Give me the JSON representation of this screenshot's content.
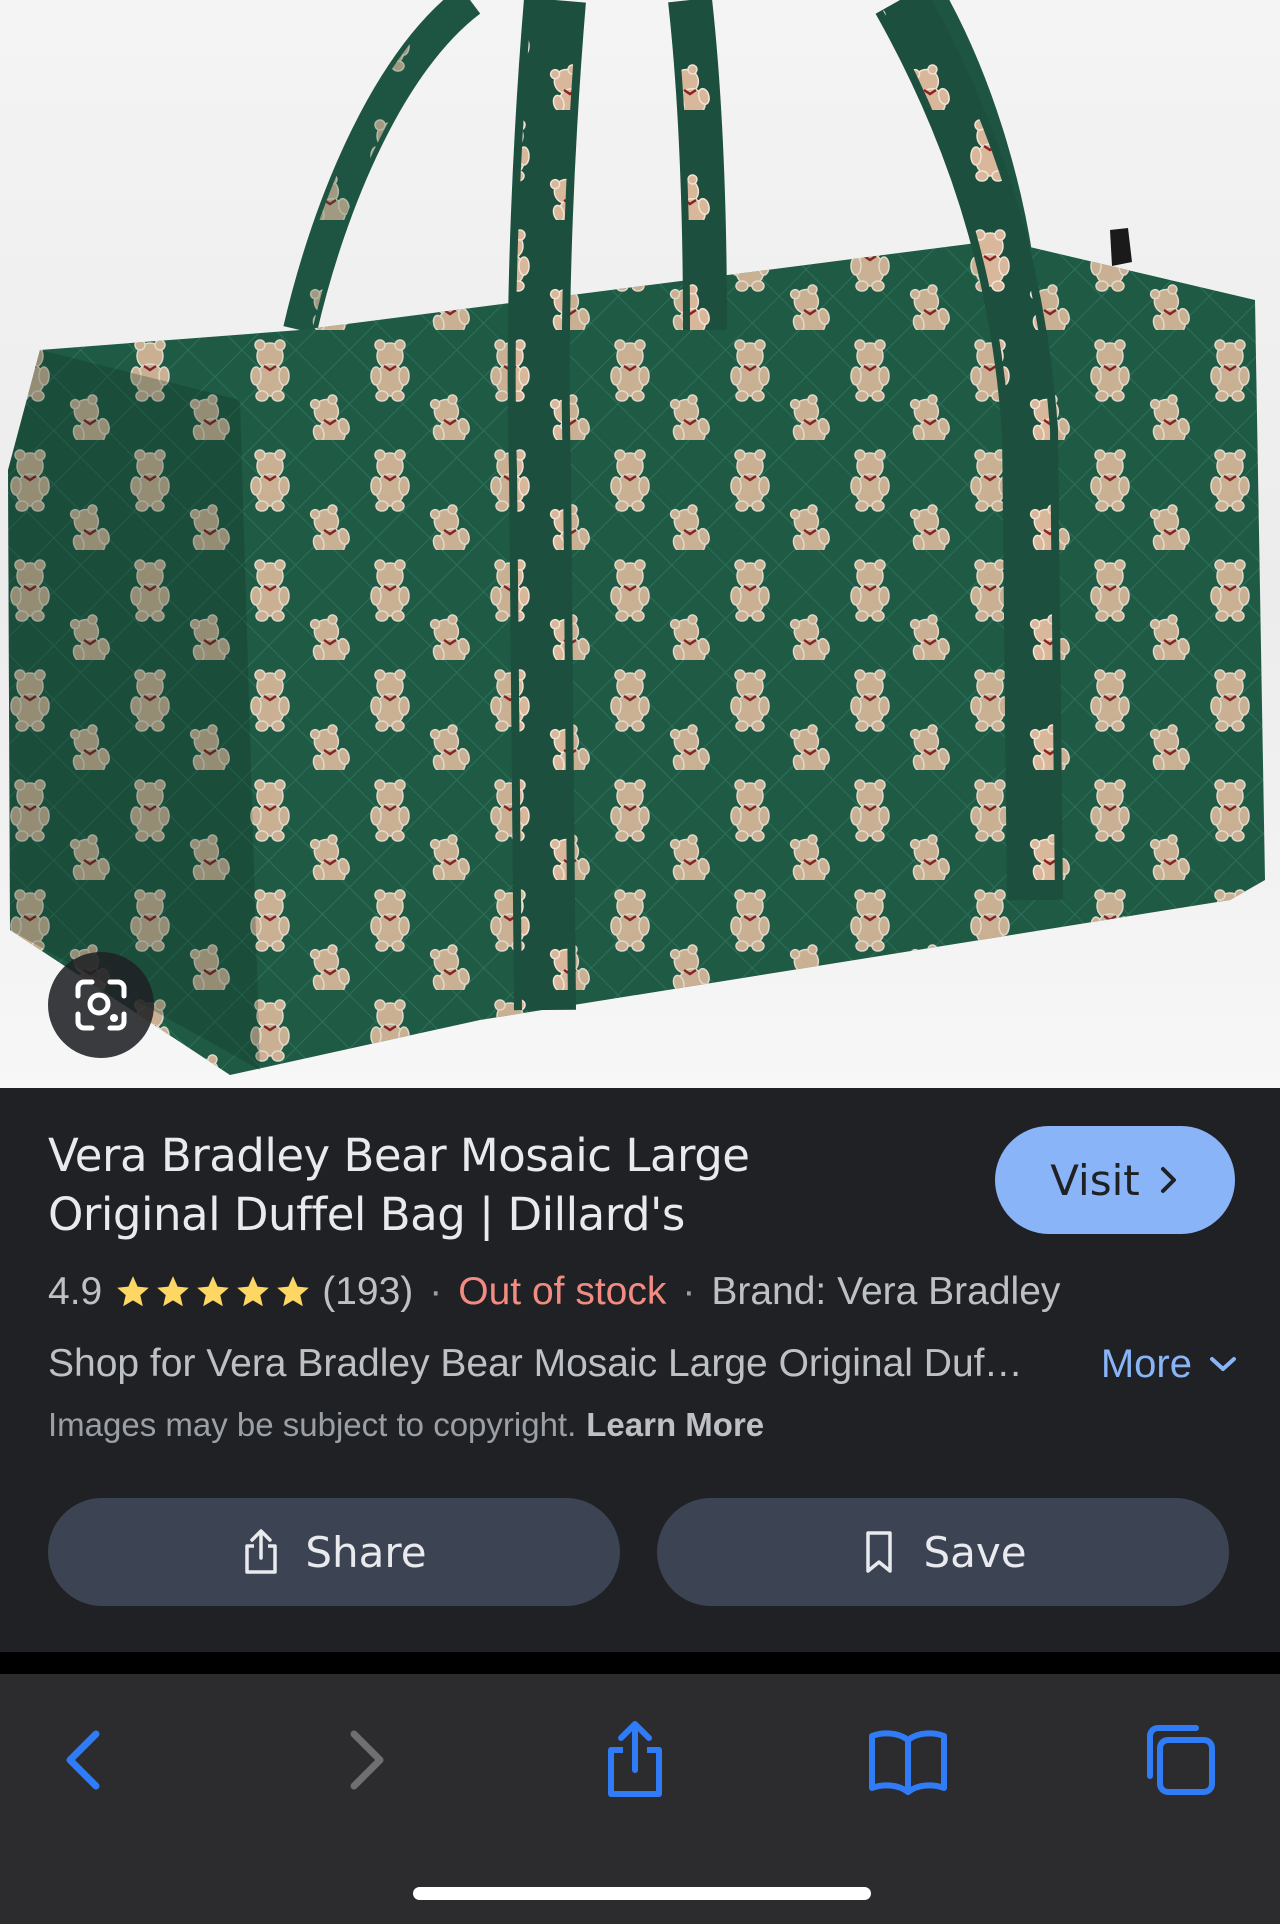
{
  "product": {
    "title": "Vera Bradley Bear Mosaic Large Original Duffel Bag | Dillard's",
    "visit_label": "Visit",
    "rating": "4.9",
    "stars": 5,
    "review_count": "(193)",
    "separator": "·",
    "stock_status": "Out of stock",
    "brand": "Brand: Vera Bradley",
    "description": "Shop for Vera Bradley Bear Mosaic Large Original Duffel Bag at Dillard's",
    "more_label": "More",
    "copyright_text": "Images may be subject to copyright.",
    "learn_more_label": "Learn More",
    "share_label": "Share",
    "save_label": "Save"
  },
  "icons": {
    "lens": "google-lens-icon",
    "visit_chevron": "chevron-right-icon",
    "star": "star-icon",
    "more_chevron": "chevron-down-icon",
    "share": "share-icon",
    "save": "bookmark-icon",
    "back": "back-arrow-icon",
    "forward": "forward-arrow-icon",
    "toolbar_share": "share-icon",
    "bookmarks": "bookmarks-book-icon",
    "tabs": "tabs-icon"
  },
  "colors": {
    "panel_bg": "#202124",
    "accent_blue": "#8ab4f8",
    "out_of_stock": "#f28b82",
    "star": "#fdd663",
    "button_bg": "#3c4453",
    "toolbar_bg": "#2c2c2e",
    "toolbar_active": "#2f7cf6",
    "toolbar_disabled": "#6e6e73",
    "bag_green": "#1f5a45"
  }
}
